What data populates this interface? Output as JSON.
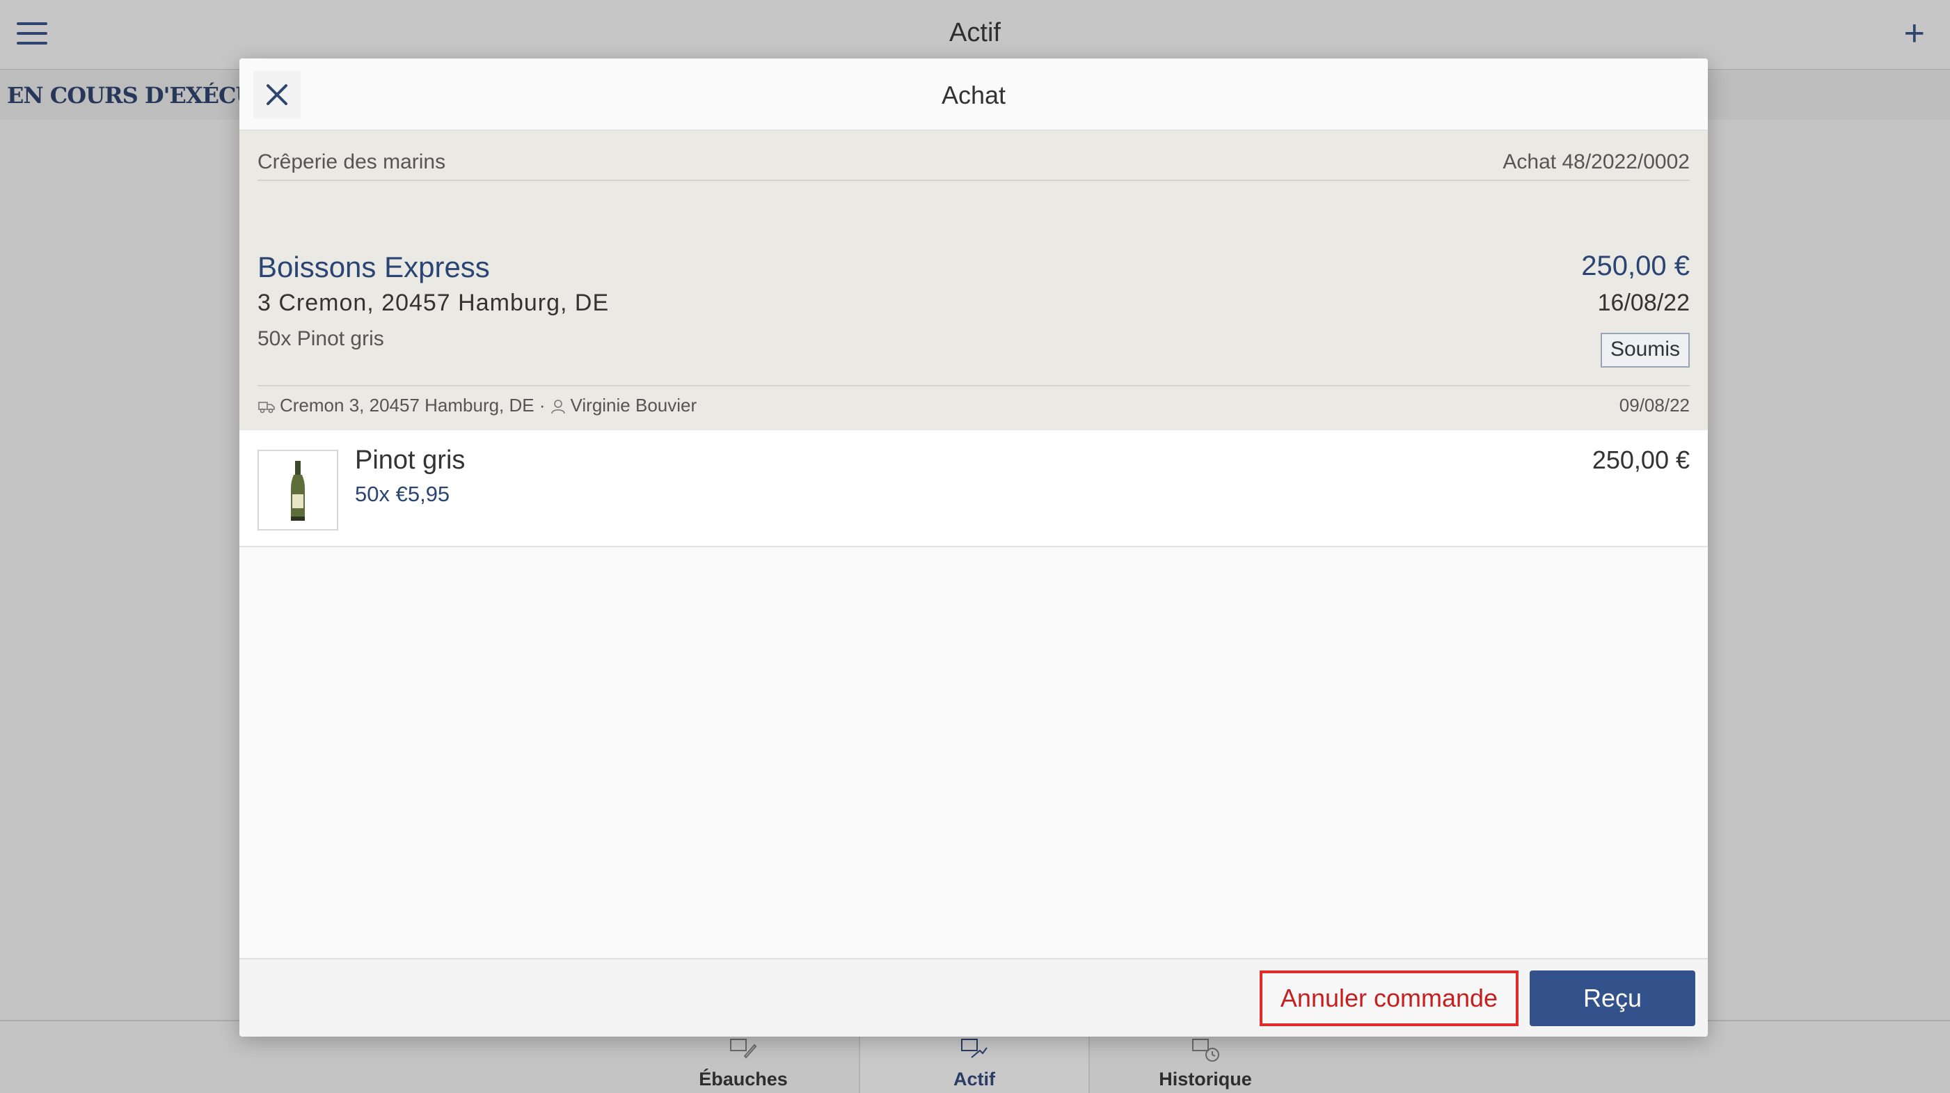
{
  "app": {
    "title": "Actif",
    "section_label": "EN COURS D'EXÉCUTION"
  },
  "bottom_nav": {
    "tabs": [
      {
        "label": "Ébauches",
        "icon": "drafts-icon"
      },
      {
        "label": "Actif",
        "icon": "active-orders-icon",
        "active": true
      },
      {
        "label": "Historique",
        "icon": "history-icon"
      }
    ]
  },
  "modal": {
    "title": "Achat",
    "venue": "Crêperie des marins",
    "order_number": "Achat 48/2022/0002",
    "supplier_name": "Boissons Express",
    "supplier_address": "3 Cremon, 20457 Hamburg, DE",
    "items_summary": "50x Pinot gris",
    "total": "250,00 €",
    "delivery_date": "16/08/22",
    "status": "Soumis",
    "delivery_address": "Cremon 3, 20457 Hamburg, DE ·",
    "created_by": "Virginie Bouvier",
    "created_date": "09/08/22",
    "line_items": [
      {
        "name": "Pinot gris",
        "quantity_price": "50x €5,95",
        "line_total": "250,00 €"
      }
    ],
    "buttons": {
      "cancel": "Annuler commande",
      "received": "Reçu"
    }
  },
  "colors": {
    "accent": "#33518a",
    "highlight_border": "#e02b2b",
    "link_blue": "#2a4573"
  }
}
